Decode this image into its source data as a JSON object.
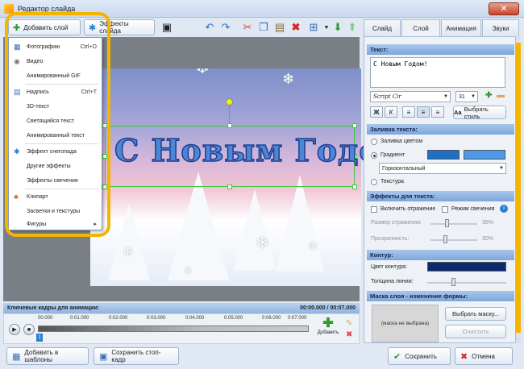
{
  "window": {
    "title": "Редактор слайда",
    "close_glyph": "✕"
  },
  "toolbar": {
    "add_layer": "Добавить слой",
    "slide_effects": "Эффекты слайда"
  },
  "menu": {
    "items": [
      {
        "label": "Фотографию",
        "shortcut": "Ctrl+O",
        "icon": "photo-icon"
      },
      {
        "label": "Видео",
        "shortcut": "",
        "icon": "video-icon"
      },
      {
        "label": "Анимированный GIF",
        "shortcut": "",
        "icon": ""
      },
      {
        "label": "Надпись",
        "shortcut": "Ctrl+T",
        "icon": "text-icon"
      },
      {
        "label": "3D-текст",
        "shortcut": "",
        "icon": ""
      },
      {
        "label": "Светящийся текст",
        "shortcut": "",
        "icon": ""
      },
      {
        "label": "Анимированный текст",
        "shortcut": "",
        "icon": ""
      },
      {
        "label": "Эффект снегопада",
        "shortcut": "",
        "icon": "snowflake-icon"
      },
      {
        "label": "Другие эффекты",
        "shortcut": "",
        "icon": ""
      },
      {
        "label": "Эффекты свечения",
        "shortcut": "",
        "icon": ""
      },
      {
        "label": "Клипарт",
        "shortcut": "",
        "icon": "clipart-icon"
      },
      {
        "label": "Засветки и текстуры",
        "shortcut": "",
        "icon": ""
      },
      {
        "label": "Фигуры",
        "shortcut": "",
        "icon": ""
      }
    ],
    "submenu_arrow": "▸"
  },
  "slide": {
    "text": "С Новым Годом!"
  },
  "timeline": {
    "title": "Ключевые кадры для анимации:",
    "time": "00:00.000 / 00:07.000",
    "ticks": [
      "00.000",
      "0:01.000",
      "0:02.000",
      "0:03.000",
      "0:04.000",
      "0:05.000",
      "0:06.000",
      "0:07.000"
    ],
    "add_label": "Добавить",
    "keyframe_number": "1"
  },
  "bottom": {
    "add_templates": "Добавить в шаблоны",
    "save_frame": "Сохранить стоп-кадр",
    "save": "Сохранить",
    "cancel": "Отмена"
  },
  "tabs": [
    "Слайд",
    "Слой",
    "Анимация",
    "Звуки"
  ],
  "text_section": {
    "header": "Текст:",
    "value": "С Новым Годом!",
    "font": "Script Cir",
    "size": "31",
    "bold": "Ж",
    "italic": "К",
    "style_button": "Выбрать стиль"
  },
  "fill_section": {
    "header": "Заливка текста:",
    "color": "Заливка цветом",
    "gradient": "Градиент",
    "gradient_type": "Горизонтальный",
    "texture": "Текстура",
    "gradient_color_1": "#1f6fc4",
    "gradient_color_2": "#4c9be8"
  },
  "effects_section": {
    "header": "Эффекты для текста:",
    "reflection": "Включить отражение",
    "glow": "Режим свечения",
    "reflection_size": "Размер отражения:",
    "reflection_value": "35%",
    "transparency": "Прозрачность:",
    "transparency_value": "30%"
  },
  "outline_section": {
    "header": "Контур:",
    "color_label": "Цвет контура:",
    "width_label": "Толщина линии:",
    "outline_color": "#0a2a6e"
  },
  "mask_section": {
    "header": "Маска слоя - изменение формы:",
    "preview": "(маска не выбрана)",
    "choose": "Выбрать маску...",
    "clear": "Очистить"
  }
}
